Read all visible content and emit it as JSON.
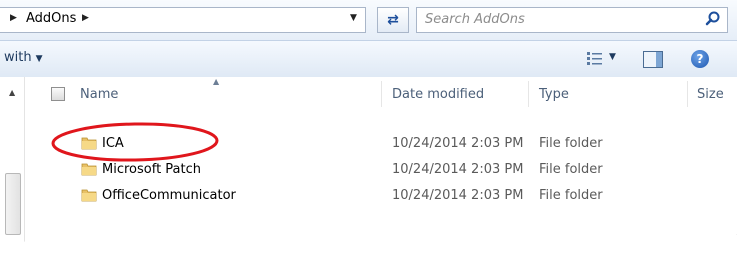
{
  "address": {
    "path_item": "AddOns"
  },
  "search": {
    "placeholder": "Search AddOns"
  },
  "toolbar": {
    "with_label": "with"
  },
  "columns": {
    "name": "Name",
    "date": "Date modified",
    "type": "Type",
    "size": "Size"
  },
  "files": [
    {
      "name": "ICA",
      "date": "10/24/2014 2:03 PM",
      "type": "File folder"
    },
    {
      "name": "Microsoft Patch",
      "date": "10/24/2014 2:03 PM",
      "type": "File folder"
    },
    {
      "name": "OfficeCommunicator",
      "date": "10/24/2014 2:03 PM",
      "type": "File folder"
    }
  ],
  "icons": [
    "chevron-right-icon",
    "chevron-down-icon",
    "refresh-icon",
    "search-icon",
    "views-icon",
    "preview-pane-icon",
    "help-icon",
    "folder-icon"
  ],
  "colors": {
    "highlight_ellipse": "#e0161c",
    "header_text": "#4c607a",
    "link_text": "#1e3a5f"
  }
}
